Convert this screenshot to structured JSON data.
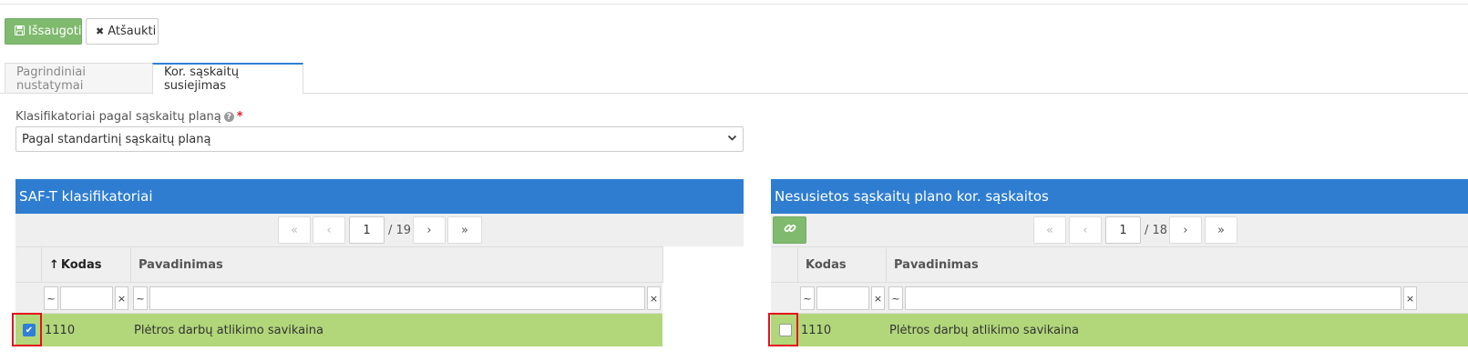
{
  "toolbar": {
    "save_label": "Išsaugoti",
    "cancel_label": "Atšaukti"
  },
  "tabs": [
    {
      "label": "Pagrindiniai nustatymai",
      "active": false
    },
    {
      "label": "Kor. sąskaitų susiejimas",
      "active": true
    }
  ],
  "form": {
    "label": "Klasifikatoriai pagal sąskaitų planą",
    "required_mark": "*",
    "selected_value": "Pagal standartinį sąskaitų planą"
  },
  "left_panel": {
    "title": "SAF-T klasifikatoriai",
    "page": "1",
    "total_pages": "/ 19",
    "columns": [
      "Kodas",
      "Pavadinimas"
    ],
    "sort_indicator": "↑",
    "filter_tilde": "~",
    "filter_clear": "×",
    "rows": [
      {
        "checked": true,
        "code": "1110",
        "name": "Plėtros darbų atlikimo savikaina"
      }
    ]
  },
  "right_panel": {
    "title": "Nesusietos sąskaitų plano kor. sąskaitos",
    "page": "1",
    "total_pages": "/ 18",
    "columns": [
      "Kodas",
      "Pavadinimas"
    ],
    "filter_tilde": "~",
    "filter_clear": "×",
    "rows": [
      {
        "checked": false,
        "code": "1110",
        "name": "Plėtros darbų atlikimo savikaina"
      }
    ]
  },
  "colors": {
    "header_blue": "#2e7dd1",
    "row_selected_green": "#b1d77a",
    "save_green": "#7fba6e",
    "highlight_red": "#e3101e"
  },
  "icons": {
    "save": "floppy-disk-icon",
    "cancel": "x-icon",
    "link": "link-icon",
    "first_page": "double-chevron-left-icon",
    "prev_page": "chevron-left-icon",
    "next_page": "chevron-right-icon",
    "last_page": "double-chevron-right-icon",
    "help": "question-circle-icon",
    "dropdown": "chevron-down-icon"
  }
}
